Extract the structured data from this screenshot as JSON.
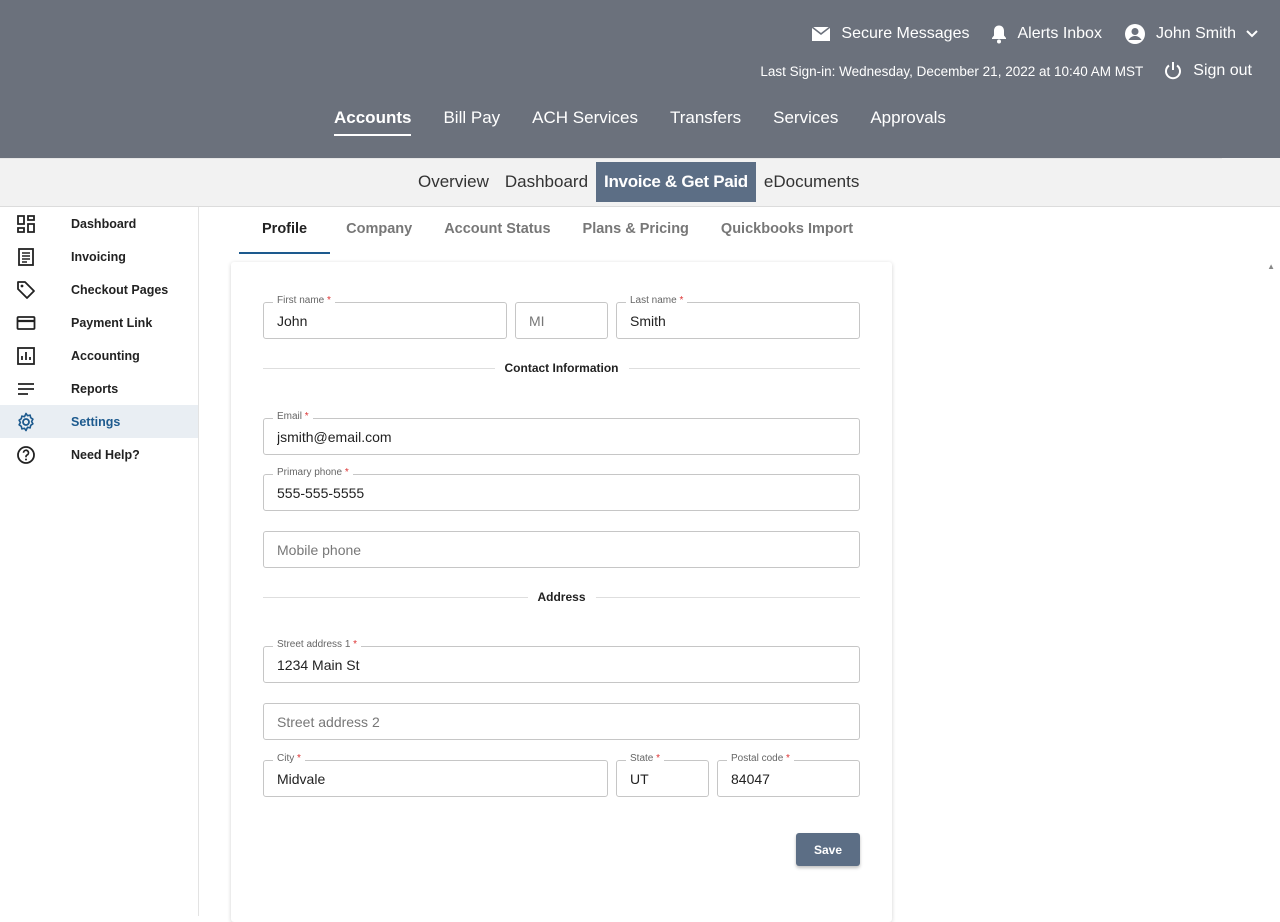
{
  "header": {
    "secure_messages": "Secure Messages",
    "alerts_inbox": "Alerts Inbox",
    "user_name": "John Smith",
    "last_signin": "Last Sign-in: Wednesday, December 21, 2022 at 10:40 AM MST",
    "sign_out": "Sign out",
    "nav": [
      "Accounts",
      "Bill Pay",
      "ACH Services",
      "Transfers",
      "Services",
      "Approvals"
    ]
  },
  "subnav": [
    "Overview",
    "Dashboard",
    "Invoice & Get Paid",
    "eDocuments"
  ],
  "sidebar": [
    {
      "label": "Dashboard",
      "icon": "dashboard-icon"
    },
    {
      "label": "Invoicing",
      "icon": "invoice-icon"
    },
    {
      "label": "Checkout Pages",
      "icon": "tag-icon"
    },
    {
      "label": "Payment Link",
      "icon": "credit-card-icon"
    },
    {
      "label": "Accounting",
      "icon": "chart-icon"
    },
    {
      "label": "Reports",
      "icon": "lines-icon"
    },
    {
      "label": "Settings",
      "icon": "gear-icon"
    },
    {
      "label": "Need Help?",
      "icon": "help-icon"
    }
  ],
  "tabs": [
    "Profile",
    "Company",
    "Account Status",
    "Plans & Pricing",
    "Quickbooks Import"
  ],
  "form": {
    "first_name_label": "First name",
    "first_name": "John",
    "mi_placeholder": "MI",
    "last_name_label": "Last name",
    "last_name": "Smith",
    "contact_heading": "Contact Information",
    "email_label": "Email",
    "email": "jsmith@email.com",
    "primary_phone_label": "Primary phone",
    "primary_phone": "555-555-5555",
    "mobile_placeholder": "Mobile phone",
    "address_heading": "Address",
    "street1_label": "Street address 1",
    "street1": "1234 Main St",
    "street2_placeholder": "Street address 2",
    "city_label": "City",
    "city": "Midvale",
    "state_label": "State",
    "state": "UT",
    "postal_label": "Postal code",
    "postal": "84047",
    "required_mark": "*",
    "save_label": "Save"
  },
  "colors": {
    "header_bg": "#6b717c",
    "accent": "#5c6e85",
    "active_link": "#1d5a8e",
    "required": "#d33333"
  }
}
